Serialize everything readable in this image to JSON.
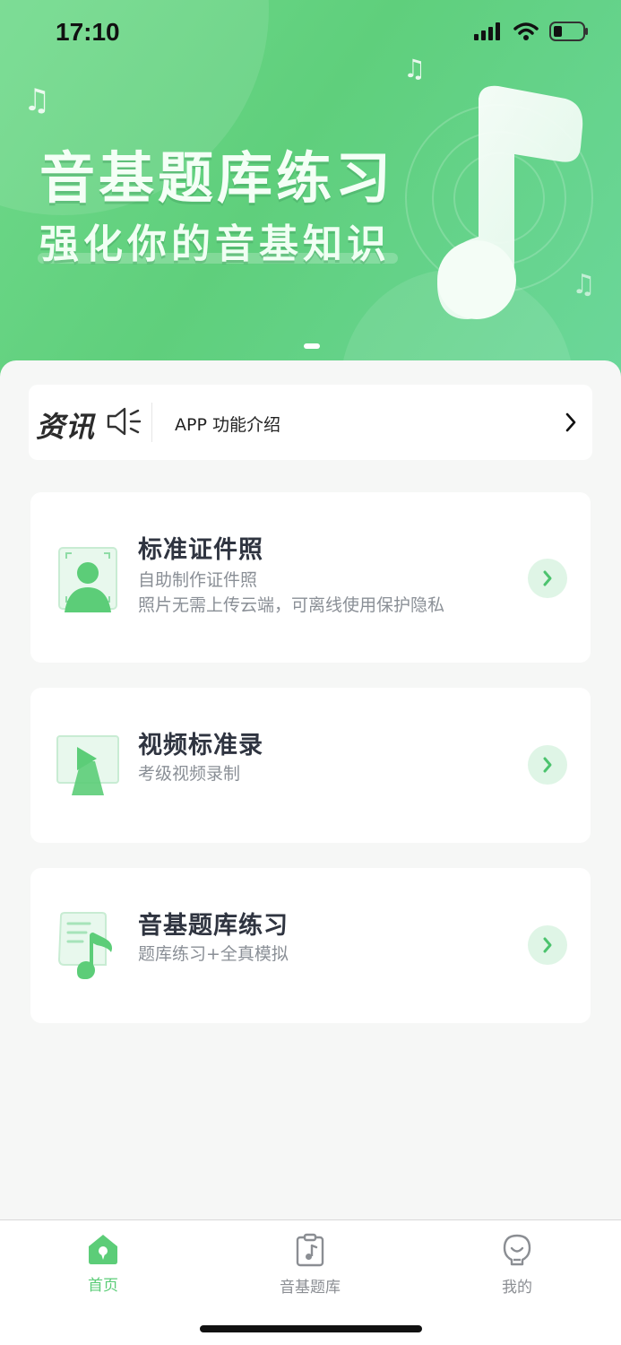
{
  "status_bar": {
    "time": "17:10"
  },
  "banner": {
    "title": "音基题库练习",
    "subtitle": "强化你的音基知识"
  },
  "news": {
    "label": "资讯",
    "text": "APP 功能介绍"
  },
  "cards": [
    {
      "title": "标准证件照",
      "desc1": "自助制作证件照",
      "desc2": "照片无需上传云端，可离线使用保护隐私"
    },
    {
      "title": "视频标准录",
      "desc1": "考级视频录制"
    },
    {
      "title": "音基题库练习",
      "desc1": "题库练习+全真模拟"
    }
  ],
  "tabbar": {
    "items": [
      {
        "label": "首页",
        "icon": "home-icon",
        "active": true
      },
      {
        "label": "音基题库",
        "icon": "music-clipboard-icon",
        "active": false
      },
      {
        "label": "我的",
        "icon": "profile-icon",
        "active": false
      }
    ]
  },
  "colors": {
    "accent": "#5ccd78",
    "banner_bg": "#62d27f",
    "inactive": "#8b8e93"
  }
}
